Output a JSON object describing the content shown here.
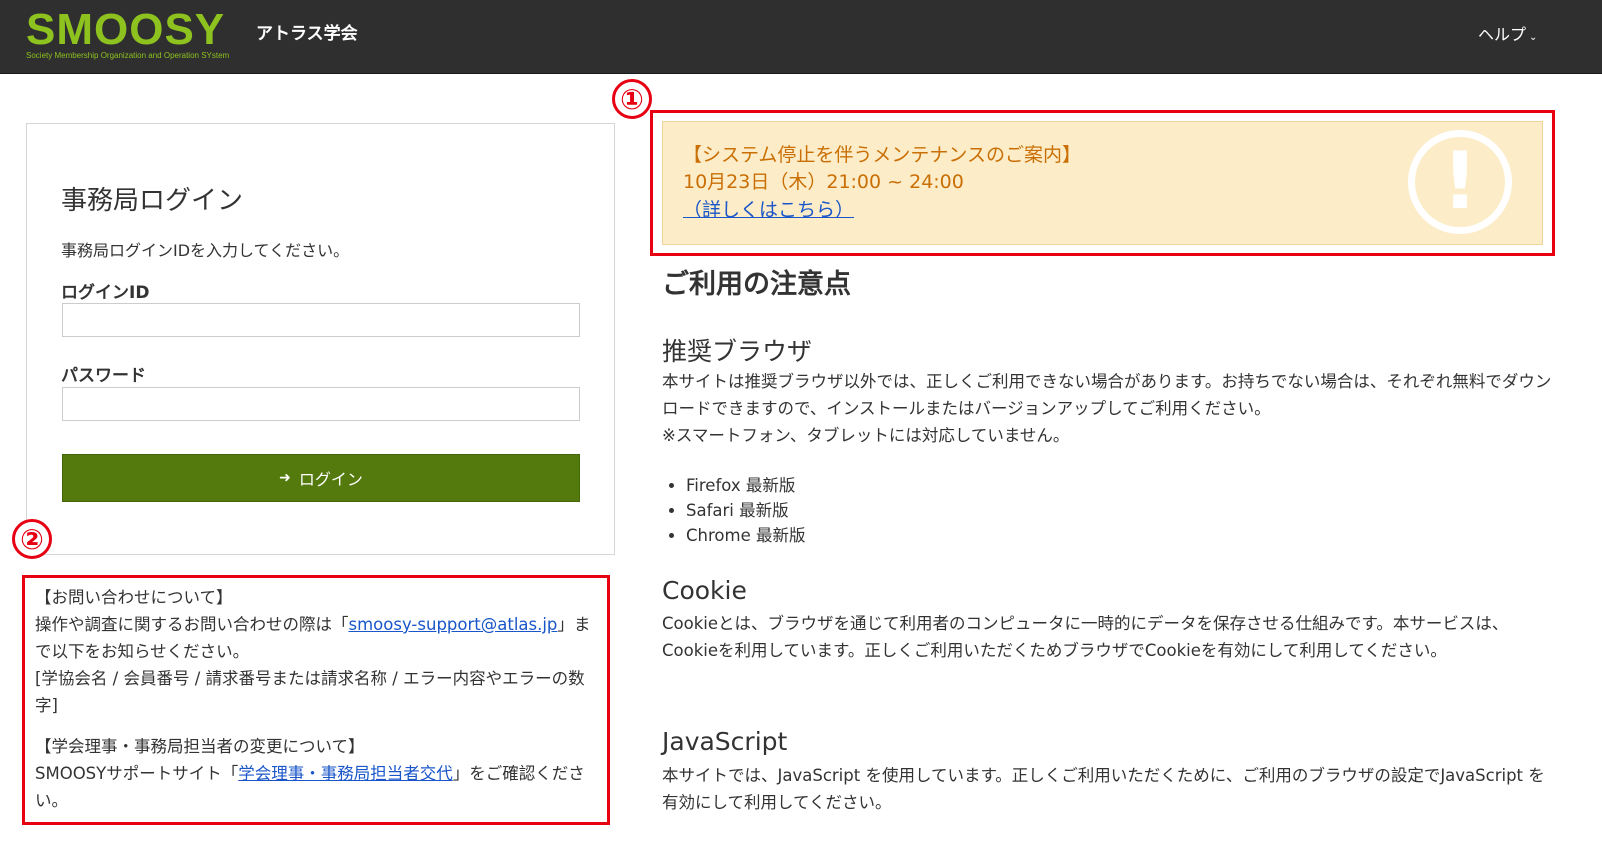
{
  "header": {
    "logo_text": "SMOOSY",
    "logo_subtitle": "Society Membership Organization and Operation SYstem",
    "society_name": "アトラス学会",
    "help_label": "ヘルプ"
  },
  "markers": {
    "one": "①",
    "two": "②"
  },
  "login": {
    "title": "事務局ログイン",
    "description": "事務局ログインIDを入力してください。",
    "id_label": "ログインID",
    "id_value": "",
    "password_label": "パスワード",
    "password_value": "",
    "button_label": "ログイン"
  },
  "inquiry": {
    "heading": "【お問い合わせについて】",
    "line_before_link": "操作や調査に関するお問い合わせの際は「",
    "email_link": "smoosy-support@atlas.jp",
    "line_after_link": "」まで以下をお知らせください。",
    "fields": "[学協会名 / 会員番号 / 請求番号または請求名称 / エラー内容やエラーの数字]",
    "change_heading": "【学会理事・事務局担当者の変更について】",
    "change_before_link": "SMOOSYサポートサイト「",
    "change_link": "学会理事・事務局担当者交代",
    "change_after_link": "」をご確認ください。"
  },
  "notice": {
    "title": "【システム停止を伴うメンテナンスのご案内】",
    "date": "10月23日（木）21:00 ~ 24:00",
    "link": "（詳しくはこちら）",
    "icon": "exclamation-circle-icon",
    "icon_glyph": "!"
  },
  "usage": {
    "heading": "ご利用の注意点",
    "browser_heading": "推奨ブラウザ",
    "browser_text": "本サイトは推奨ブラウザ以外では、正しくご利用できない場合があります。お持ちでない場合は、それぞれ無料でダウンロードできますので、インストールまたはバージョンアップしてご利用ください。",
    "browser_note": "※スマートフォン、タブレットには対応していません。",
    "browsers": [
      "Firefox 最新版",
      "Safari 最新版",
      "Chrome 最新版"
    ],
    "cookie_heading": "Cookie",
    "cookie_text": "Cookieとは、ブラウザを通じて利用者のコンピュータに一時的にデータを保存させる仕組みです。本サービスは、Cookieを利用しています。正しくご利用いただくためブラウザでCookieを有効にして利用してください。",
    "js_heading": "JavaScript",
    "js_text": "本サイトでは、JavaScript を使用しています。正しくご利用いただくために、ご利用のブラウザの設定でJavaScript を有効にして利用してください。"
  },
  "colors": {
    "header_bg": "#2f2f2f",
    "logo_green": "#8dc21f",
    "login_button": "#547a0e",
    "highlight_red": "#e60012",
    "notice_bg": "#fcecc8",
    "notice_text": "#c96f05",
    "link": "#1a56c9"
  }
}
